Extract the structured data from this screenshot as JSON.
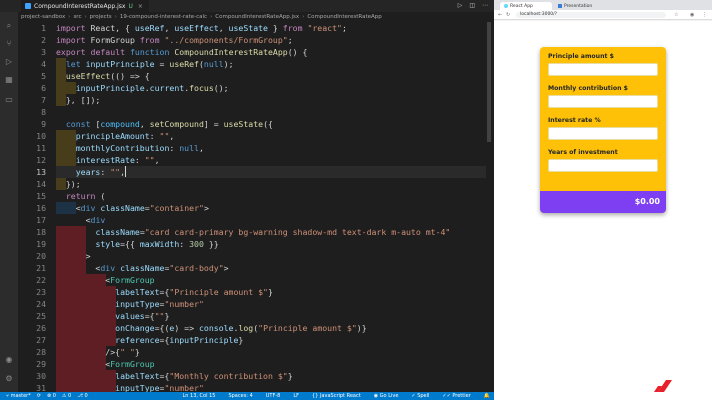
{
  "editor": {
    "tab": {
      "label": "CompoundInterestRateApp.jsx",
      "status": "U"
    },
    "breadcrumb": [
      "project-sandbox",
      "src",
      "projects",
      "19-compound-interest-rate-calc",
      "CompoundInterestRateApp.jsx",
      "CompoundInterestRateApp"
    ],
    "line_numbers": [
      "1",
      "2",
      "3",
      "4",
      "5",
      "6",
      "7",
      "8",
      "9",
      "10",
      "11",
      "12",
      "13",
      "14",
      "15",
      "16",
      "17",
      "18",
      "19",
      "20",
      "21",
      "22",
      "23",
      "24",
      "25",
      "26",
      "27",
      "28",
      "29",
      "30",
      "31"
    ],
    "active_line": "13",
    "status_bar": {
      "branch": "master*",
      "errors": "0",
      "warnings": "0",
      "ports": "0",
      "position": "Ln 13, Col 15",
      "spaces": "Spaces: 4",
      "encoding": "UTF-8",
      "eol": "LF",
      "language": "JavaScript React",
      "golive": "Go Live",
      "spell": "Spell",
      "prettier": "Prettier"
    },
    "code": {
      "l1": [
        "import",
        " React, { ",
        "useRef",
        ", ",
        "useEffect",
        ", ",
        "useState",
        " } ",
        "from",
        " ",
        "\"react\"",
        ";"
      ],
      "l2": [
        "import",
        " FormGroup ",
        "from",
        " ",
        "\"../components/FormGroup\"",
        ";"
      ],
      "l3": [
        "export",
        " ",
        "default",
        " ",
        "function",
        " ",
        "CompoundInterestRateApp",
        "() {"
      ],
      "l4": [
        "  ",
        "let",
        " ",
        "inputPrinciple",
        " = ",
        "useRef",
        "(",
        "null",
        ");"
      ],
      "l5": [
        "  ",
        "useEffect",
        "(() => {"
      ],
      "l6": [
        "    ",
        "inputPrinciple",
        ".",
        "current",
        ".",
        "focus",
        "();"
      ],
      "l7": [
        "  }, []);"
      ],
      "l8": [
        ""
      ],
      "l9": [
        "  ",
        "const",
        " [",
        "compound",
        ", ",
        "setCompound",
        "] = ",
        "useState",
        "({"
      ],
      "l10": [
        "    ",
        "principleAmount",
        ": ",
        "\"\"",
        ","
      ],
      "l11": [
        "    ",
        "monthlyContribution",
        ": ",
        "null",
        ","
      ],
      "l12": [
        "    ",
        "interestRate",
        ": ",
        "\"\"",
        ","
      ],
      "l13": [
        "    ",
        "years",
        ": ",
        "\"\"",
        ","
      ],
      "l14": [
        "  });"
      ],
      "l15": [
        "  ",
        "return",
        " ("
      ],
      "l16": [
        "    <",
        "div",
        " ",
        "className",
        "=",
        "\"container\"",
        ">"
      ],
      "l17": [
        "      <",
        "div"
      ],
      "l18": [
        "        ",
        "className",
        "=",
        "\"card card-primary bg-warning shadow-md text-dark m-auto mt-4\""
      ],
      "l19": [
        "        ",
        "style",
        "={{ ",
        "maxWidth",
        ": ",
        "300",
        " }}"
      ],
      "l20": [
        "      >"
      ],
      "l21": [
        "        <",
        "div",
        " ",
        "className",
        "=",
        "\"card-body\"",
        ">"
      ],
      "l22": [
        "          <",
        "FormGroup"
      ],
      "l23": [
        "            ",
        "labelText",
        "={",
        "\"Principle amount $\"",
        "}"
      ],
      "l24": [
        "            ",
        "inputType",
        "=",
        "\"number\""
      ],
      "l25": [
        "            ",
        "values",
        "={",
        "\"\"",
        "}"
      ],
      "l26": [
        "            ",
        "onChange",
        "={(",
        "e",
        ") => ",
        "console",
        ".",
        "log",
        "(",
        "\"Principle amount $\"",
        ")}"
      ],
      "l27": [
        "            ",
        "reference",
        "={",
        "inputPrinciple",
        "}"
      ],
      "l28": [
        "          />{",
        "\" \"",
        "}"
      ],
      "l29": [
        "          <",
        "FormGroup"
      ],
      "l30": [
        "            ",
        "labelText",
        "={",
        "\"Monthly contribution $\"",
        "}"
      ],
      "l31": [
        "            ",
        "inputType",
        "=",
        "\"number\""
      ]
    }
  },
  "browser": {
    "tabs": [
      "React App",
      "Presentation"
    ],
    "url": "localhost:3000/?",
    "form": {
      "principle_label": "Principle amount $",
      "monthly_label": "Monthly contribution $",
      "interest_label": "Interest rate %",
      "years_label": "Years of investment",
      "total": "$0.00"
    }
  },
  "colors": {
    "card": "#ffc107",
    "footer": "#7e3ff2",
    "statusbar": "#007acc"
  }
}
